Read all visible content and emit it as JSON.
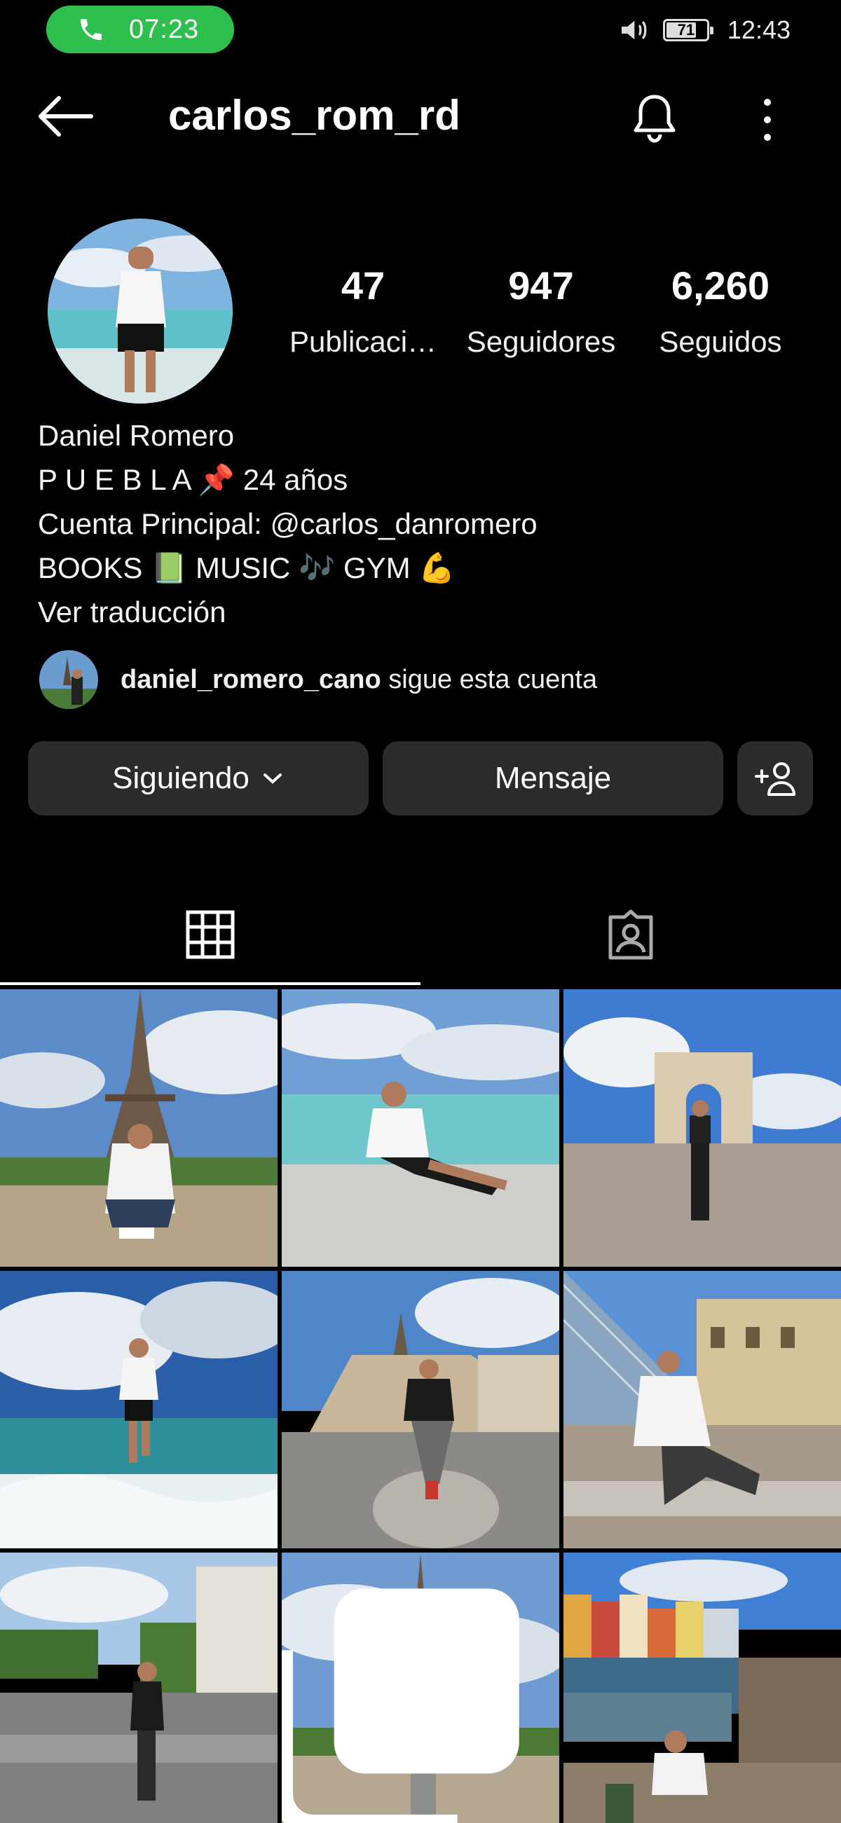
{
  "status_bar": {
    "call_time": "07:23",
    "battery": "71",
    "clock": "12:43"
  },
  "header": {
    "username": "carlos_rom_rd"
  },
  "stats": [
    {
      "value": "47",
      "label": "Publicaci…"
    },
    {
      "value": "947",
      "label": "Seguidores"
    },
    {
      "value": "6,260",
      "label": "Seguidos"
    }
  ],
  "bio": {
    "name": "Daniel Romero",
    "line1": "P U E B L A 📌 24 años",
    "line2": "Cuenta Principal: @carlos_danromero",
    "line3": "BOOKS 📗 MUSIC 🎶 GYM 💪",
    "translate": "Ver traducción"
  },
  "followed_by": {
    "username": "daniel_romero_cano",
    "suffix": " sigue esta cuenta"
  },
  "buttons": {
    "following": "Siguiendo",
    "message": "Mensaje"
  },
  "colors": {
    "call_green": "#2fbf4f",
    "button_bg": "#2b2b2b",
    "background": "#000000"
  },
  "icons": [
    "phone-icon",
    "volume-icon",
    "battery-icon",
    "back-arrow-icon",
    "bell-icon",
    "more-vertical-icon",
    "chevron-down-icon",
    "add-user-icon",
    "grid-icon",
    "tagged-icon",
    "multiple-photos-icon"
  ]
}
